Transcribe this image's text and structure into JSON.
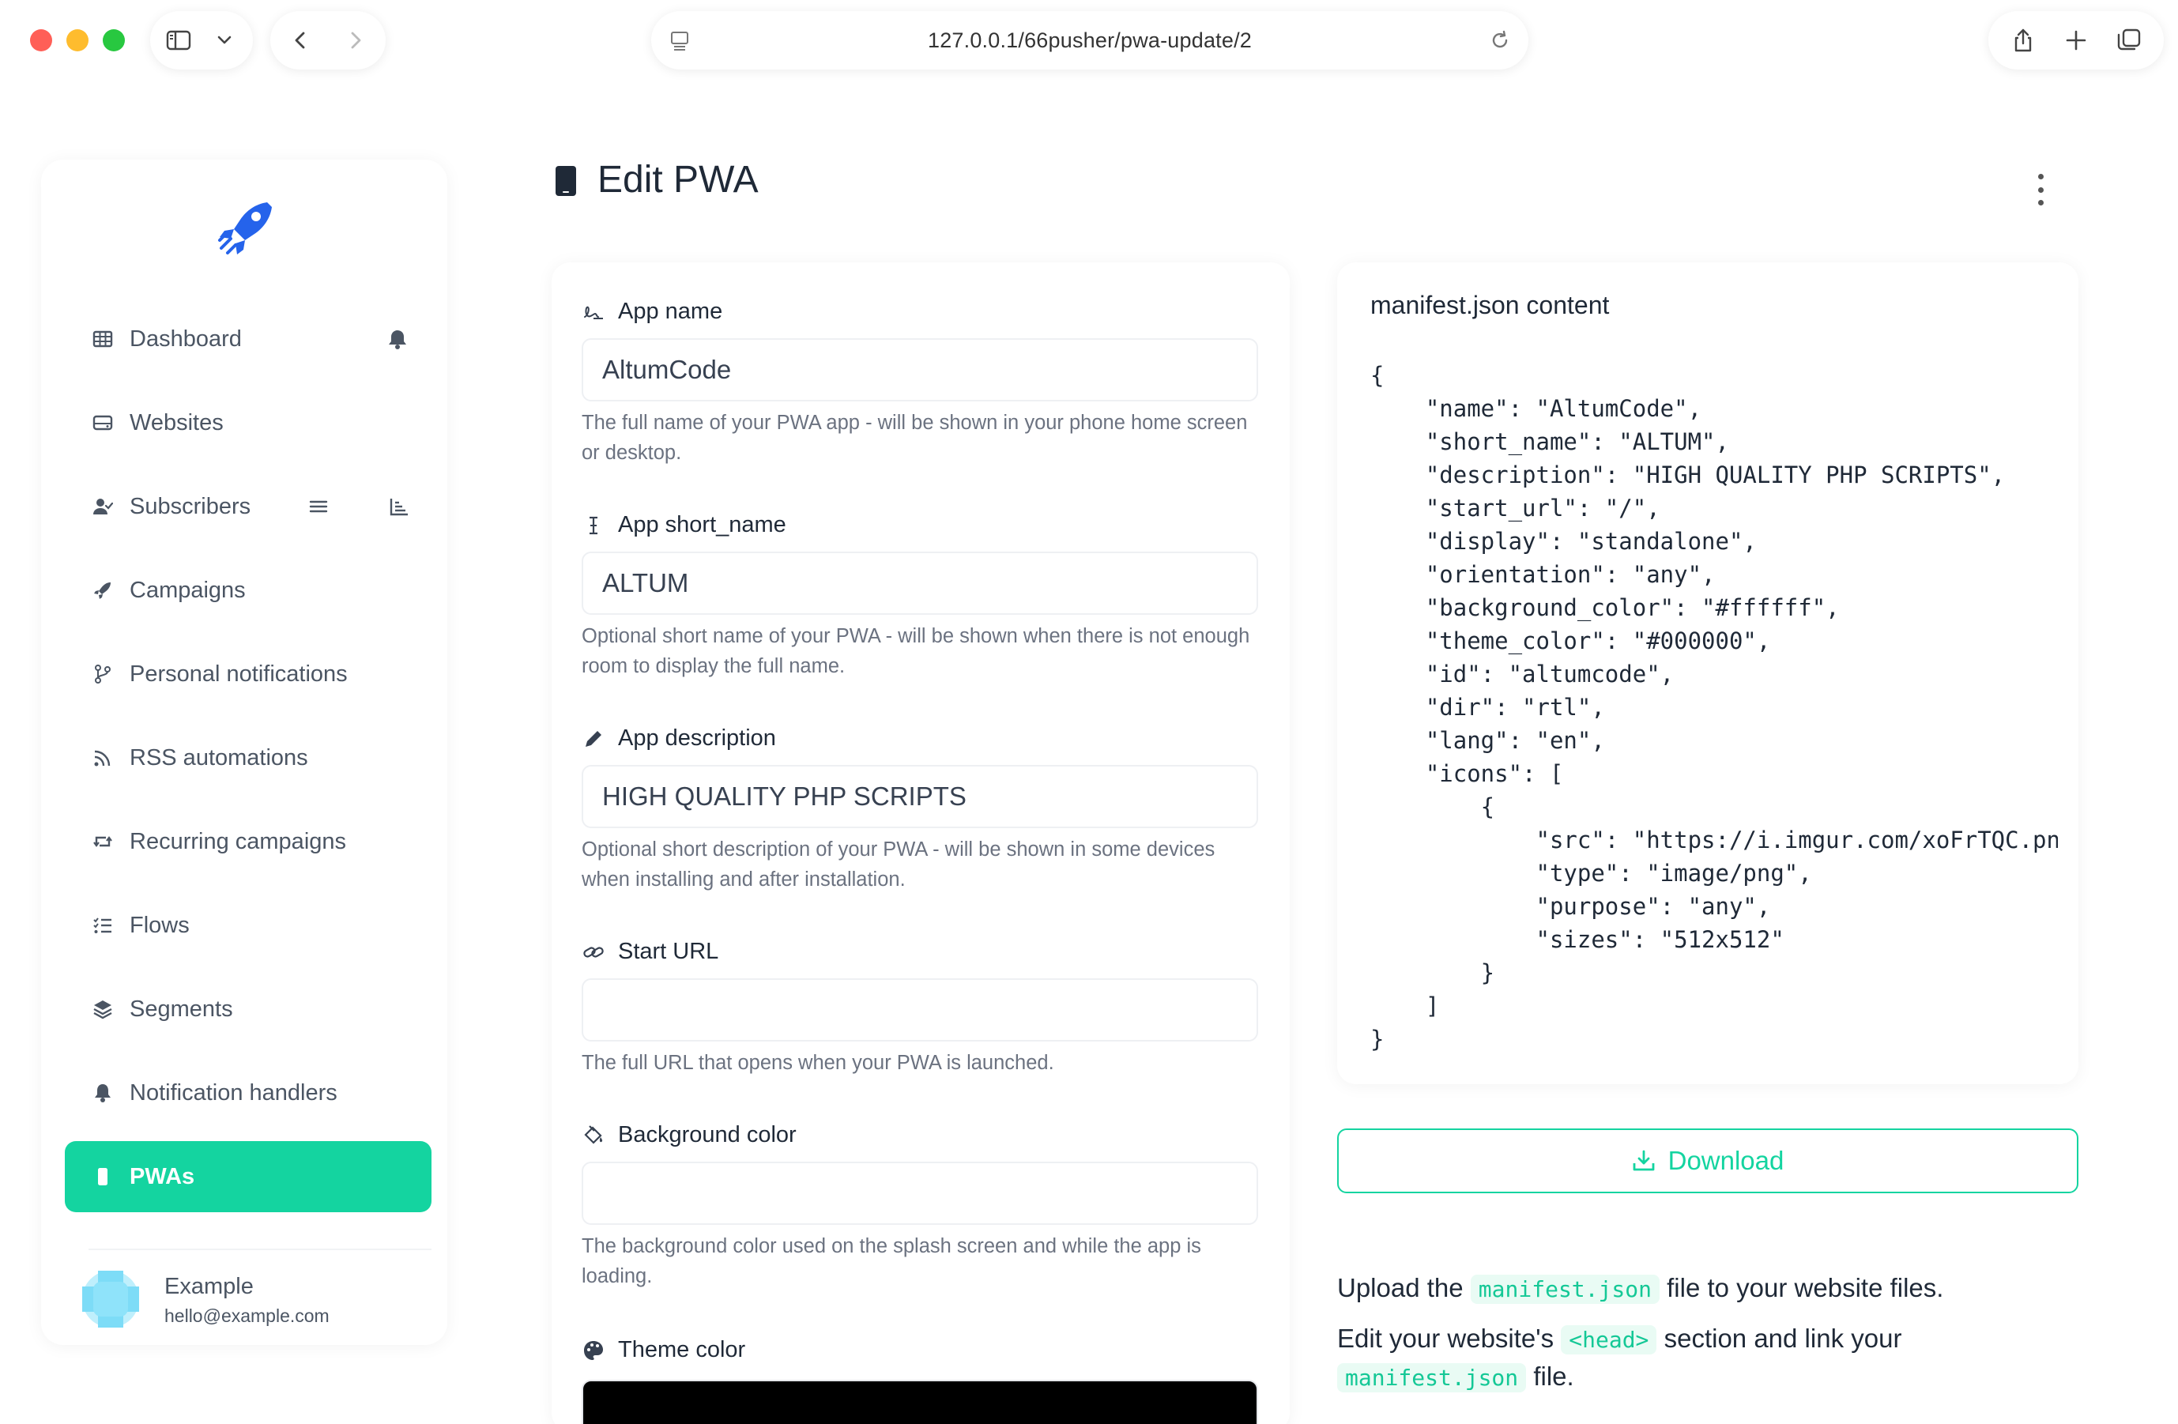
{
  "browser": {
    "url": "127.0.0.1/66pusher/pwa-update/2"
  },
  "sidebar": {
    "items": [
      {
        "label": "Dashboard",
        "icon": "table-icon"
      },
      {
        "label": "Websites",
        "icon": "hdd-icon"
      },
      {
        "label": "Subscribers",
        "icon": "user-check-icon"
      },
      {
        "label": "Campaigns",
        "icon": "rocket-icon"
      },
      {
        "label": "Personal notifications",
        "icon": "code-branch-icon"
      },
      {
        "label": "RSS automations",
        "icon": "rss-icon"
      },
      {
        "label": "Recurring campaigns",
        "icon": "retweet-icon"
      },
      {
        "label": "Flows",
        "icon": "tasks-icon"
      },
      {
        "label": "Segments",
        "icon": "layer-group-icon"
      },
      {
        "label": "Notification handlers",
        "icon": "bell-icon"
      },
      {
        "label": "PWAs",
        "icon": "mobile-icon",
        "active": true
      }
    ],
    "user": {
      "name": "Example",
      "email": "hello@example.com"
    }
  },
  "header": {
    "title": "Edit PWA"
  },
  "form": {
    "app_name": {
      "label": "App name",
      "value": "AltumCode",
      "help": "The full name of your PWA app - will be shown in your phone home screen or desktop."
    },
    "short_name": {
      "label": "App short_name",
      "value": "ALTUM",
      "help": "Optional short name of your PWA - will be shown when there is not enough room to display the full name."
    },
    "description": {
      "label": "App description",
      "value": "HIGH QUALITY PHP SCRIPTS",
      "help": "Optional short description of your PWA - will be shown in some devices when installing and after installation."
    },
    "start_url": {
      "label": "Start URL",
      "value": "",
      "help": "The full URL that opens when your PWA is launched."
    },
    "background_color": {
      "label": "Background color",
      "value": "#ffffff",
      "help": "The background color used on the splash screen and while the app is loading."
    },
    "theme_color": {
      "label": "Theme color",
      "value": "#000000"
    }
  },
  "manifest": {
    "title": "manifest.json content",
    "content": "{\n    \"name\": \"AltumCode\",\n    \"short_name\": \"ALTUM\",\n    \"description\": \"HIGH QUALITY PHP SCRIPTS\",\n    \"start_url\": \"/\",\n    \"display\": \"standalone\",\n    \"orientation\": \"any\",\n    \"background_color\": \"#ffffff\",\n    \"theme_color\": \"#000000\",\n    \"id\": \"altumcode\",\n    \"dir\": \"rtl\",\n    \"lang\": \"en\",\n    \"icons\": [\n        {\n            \"src\": \"https://i.imgur.com/xoFrTQC.png\",\n            \"type\": \"image/png\",\n            \"purpose\": \"any\",\n            \"sizes\": \"512x512\"\n        }\n    ]\n}"
  },
  "download": {
    "label": "Download"
  },
  "instructions": {
    "line1_before": "Upload the",
    "line1_code": "manifest.json",
    "line1_after": "file to your website files.",
    "line2_before": "Edit your website's",
    "line2_code": "<head>",
    "line2_after": "section and link your",
    "line3_code": "manifest.json",
    "line3_after": "file."
  },
  "colors": {
    "accent": "#14d4a0",
    "brand_blue": "#2563eb"
  }
}
